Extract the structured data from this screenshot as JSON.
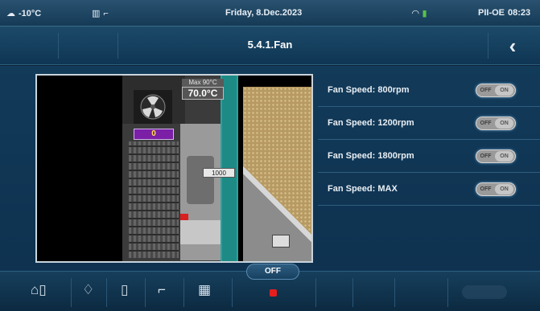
{
  "status": {
    "temperature": "-10°C",
    "date": "Friday, 8.Dec.2023",
    "station": "PII-OE",
    "time": "08:23"
  },
  "header": {
    "title": "5.4.1.Fan",
    "back_icon": "chevron-left-icon"
  },
  "diagram": {
    "max_label": "Max 90°C",
    "temperature": "70.0°C",
    "counter": "0",
    "speed": "1000"
  },
  "fan_speeds": [
    {
      "label": "Fan Speed: 800rpm",
      "off": "OFF",
      "on": "ON"
    },
    {
      "label": "Fan Speed: 1200rpm",
      "off": "OFF",
      "on": "ON"
    },
    {
      "label": "Fan Speed: 1800rpm",
      "off": "OFF",
      "on": "ON"
    },
    {
      "label": "Fan Speed: MAX",
      "off": "OFF",
      "on": "ON"
    }
  ],
  "bottom": {
    "off_label": "OFF"
  }
}
